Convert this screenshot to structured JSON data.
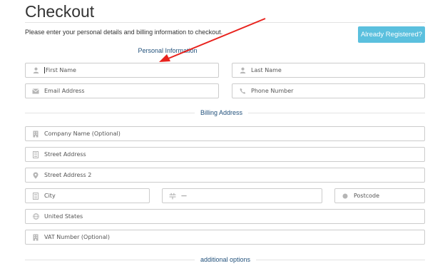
{
  "page": {
    "title": "Checkout",
    "intro": "Please enter your personal details and billing information to checkout.",
    "already_registered_label": "Already Registered?"
  },
  "sections": {
    "personal": "Personal Information",
    "billing": "Billing Address",
    "additional": "additional options"
  },
  "personal_fields": {
    "first_name": "First Name",
    "last_name": "Last Name",
    "email": "Email Address",
    "phone": "Phone Number"
  },
  "billing_fields": {
    "company": "Company Name (Optional)",
    "street": "Street Address",
    "street2": "Street Address 2",
    "city": "City",
    "state": "—",
    "postcode": "Postcode",
    "country": "United States",
    "vat": "VAT Number (Optional)"
  },
  "colors": {
    "accent_button": "#5bc0de",
    "section_text": "#23527c",
    "annotation_arrow": "#e8221d"
  },
  "icons": [
    "user-icon",
    "envelope-icon",
    "phone-icon",
    "building-icon",
    "map-marker-icon",
    "state-icon",
    "postcode-icon",
    "globe-icon"
  ]
}
